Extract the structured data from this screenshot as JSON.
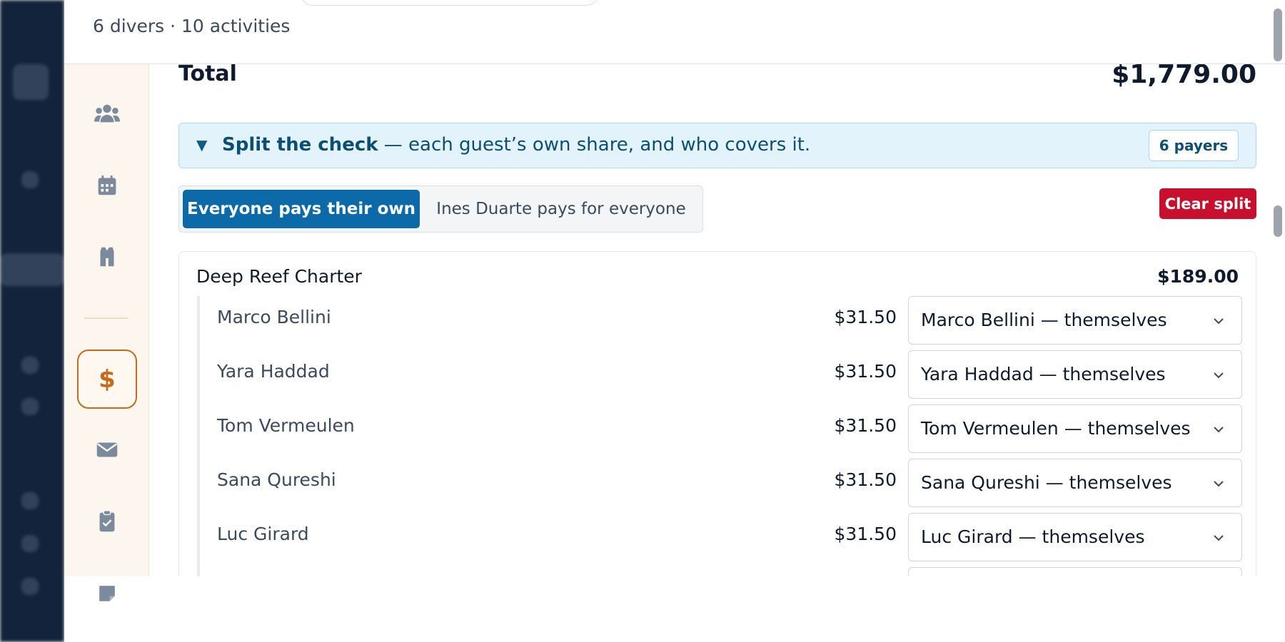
{
  "header": {
    "meta": "6 divers · 10 activities"
  },
  "rail": {
    "items": [
      {
        "icon": "users-icon"
      },
      {
        "icon": "calendar-icon"
      },
      {
        "icon": "wetsuit-icon"
      },
      {
        "icon": "dollar-icon",
        "label": "$",
        "active": true
      },
      {
        "icon": "envelope-icon"
      },
      {
        "icon": "clipboard-check-icon"
      },
      {
        "icon": "note-icon"
      }
    ]
  },
  "total": {
    "label": "Total",
    "value": "$1,779.00"
  },
  "split": {
    "title_bold": "Split the check",
    "title_rest": " — each guest’s own share, and who covers it.",
    "payers_badge": "6 payers",
    "toggle_icon": "caret-down"
  },
  "modes": {
    "active": "Everyone pays their own",
    "other": "Ines Duarte pays for everyone"
  },
  "clear_label": "Clear split",
  "activity": {
    "name": "Deep Reef Charter",
    "total": "$189.00",
    "guests": [
      {
        "name": "Marco Bellini",
        "amount": "$31.50",
        "payer": "Marco Bellini — themselves"
      },
      {
        "name": "Yara Haddad",
        "amount": "$31.50",
        "payer": "Yara Haddad — themselves"
      },
      {
        "name": "Tom Vermeulen",
        "amount": "$31.50",
        "payer": "Tom Vermeulen — themselves"
      },
      {
        "name": "Sana Qureshi",
        "amount": "$31.50",
        "payer": "Sana Qureshi — themselves"
      },
      {
        "name": "Luc Girard",
        "amount": "$31.50",
        "payer": "Luc Girard — themselves"
      }
    ]
  },
  "colors": {
    "primary": "#0d6aa8",
    "danger": "#c8102e",
    "accent": "#c66a1b",
    "banner_bg": "#e3f3fb"
  }
}
